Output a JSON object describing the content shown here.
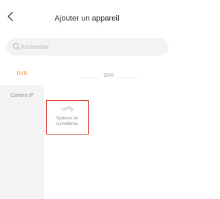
{
  "header": {
    "title": "Ajouter un appareil",
    "back_icon": "chevron-left-icon"
  },
  "search": {
    "placeholder": "Rechercher",
    "value": "",
    "icon": "search-icon"
  },
  "sidebar": {
    "items": [
      {
        "label": "DVR",
        "active": true
      },
      {
        "label": "Caméra IP",
        "active": false
      }
    ]
  },
  "main": {
    "section_title": "DVR",
    "devices": [
      {
        "label": "Système de surveillance",
        "icon": "camera-dvr-icon"
      }
    ]
  },
  "colors": {
    "accent": "#e89232",
    "selection_border": "#d8362d",
    "sidebar_bg": "#f4f4f4",
    "muted_text": "#8d8d8d"
  }
}
